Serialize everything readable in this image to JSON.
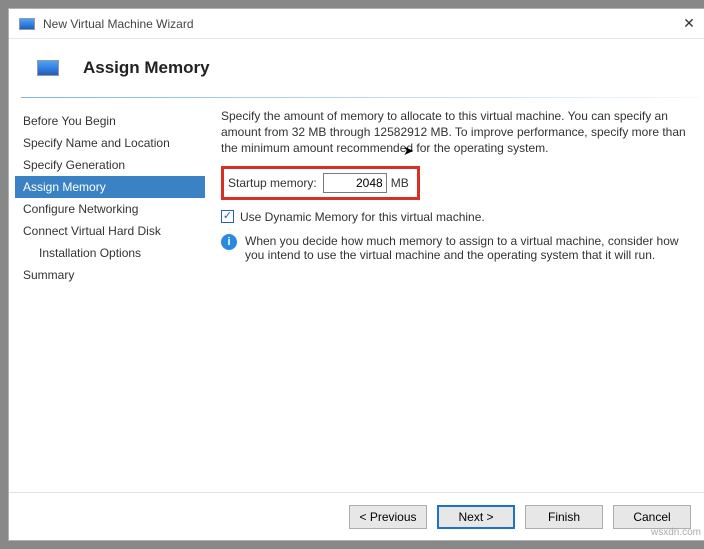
{
  "titlebar": {
    "title": "New Virtual Machine Wizard"
  },
  "header": {
    "title": "Assign Memory"
  },
  "sidebar": {
    "items": [
      {
        "label": "Before You Begin",
        "selected": false
      },
      {
        "label": "Specify Name and Location",
        "selected": false
      },
      {
        "label": "Specify Generation",
        "selected": false
      },
      {
        "label": "Assign Memory",
        "selected": true
      },
      {
        "label": "Configure Networking",
        "selected": false
      },
      {
        "label": "Connect Virtual Hard Disk",
        "selected": false
      },
      {
        "label": "Installation Options",
        "selected": false,
        "indent": true
      },
      {
        "label": "Summary",
        "selected": false
      }
    ]
  },
  "content": {
    "description": "Specify the amount of memory to allocate to this virtual machine. You can specify an amount from 32 MB through 12582912 MB. To improve performance, specify more than the minimum amount recommended for the operating system.",
    "memory_label": "Startup memory:",
    "memory_value": "2048",
    "memory_unit": "MB",
    "dynamic_label": "Use Dynamic Memory for this virtual machine.",
    "info_text": "When you decide how much memory to assign to a virtual machine, consider how you intend to use the virtual machine and the operating system that it will run."
  },
  "footer": {
    "previous": "< Previous",
    "next": "Next >",
    "finish": "Finish",
    "cancel": "Cancel"
  },
  "watermark": "wsxdn.com"
}
